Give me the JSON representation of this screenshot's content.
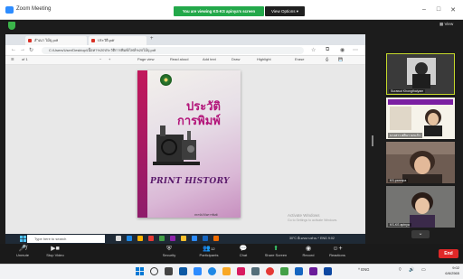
{
  "zoom": {
    "window_title": "Zoom Meeting",
    "share_banner": "You are viewing KS-KS apinya's screen",
    "view_options": "View Options",
    "view_button": "View",
    "end_label": "End"
  },
  "browser": {
    "tabs": [
      "สำเนา ไม้บุ.pdf",
      "ประวัติ.pdf"
    ],
    "url": "C:/Users/User/Desktop/เนื้อหา%20ประวัติการพิมพ์/ไฟล์%20ไม้บุ.pdf",
    "pdf_toolbar": [
      "Page view",
      "Read aloud",
      "Add text",
      "Draw",
      "Highlight",
      "Erase"
    ],
    "page_indicator": "of 1"
  },
  "cover": {
    "title_th_line1": "ประวัติ",
    "title_th_line2": "การพิมพ์",
    "title_en": "PRINT HISTORY",
    "author": "สถาบันวิจัยการพิมพ์"
  },
  "watermark": {
    "line1": "Activate Windows",
    "line2": "Go to Settings to activate Windows."
  },
  "inner_taskbar": {
    "search_placeholder": "Type here to search",
    "tray": "30°C  มีเมฆบางส่วน  ^ ENG  9:02"
  },
  "participants": [
    {
      "name": "Surawut Khongthaiyam"
    },
    {
      "name": "นางสาว ศศินา นกแก้ว"
    },
    {
      "name": "KS-pannipa"
    },
    {
      "name": "KS-KS apinya"
    }
  ],
  "controls": [
    {
      "label": "Unmute",
      "icon": "mic-muted-icon"
    },
    {
      "label": "Stop Video",
      "icon": "video-icon"
    },
    {
      "label": "Security",
      "icon": "shield-icon"
    },
    {
      "label": "Participants",
      "icon": "people-icon",
      "count": "12"
    },
    {
      "label": "Chat",
      "icon": "chat-icon"
    },
    {
      "label": "Share Screen",
      "icon": "share-icon"
    },
    {
      "label": "Record",
      "icon": "record-icon"
    },
    {
      "label": "Reactions",
      "icon": "reactions-icon"
    }
  ],
  "host_taskbar": {
    "tray": "^  ENG",
    "time": "9:02",
    "date": "6/6/2565"
  },
  "colors": {
    "share_banner": "#23a84a",
    "end_button": "#e02828",
    "cover_title": "#b3157a",
    "active_speaker_border": "#c5d92b"
  }
}
